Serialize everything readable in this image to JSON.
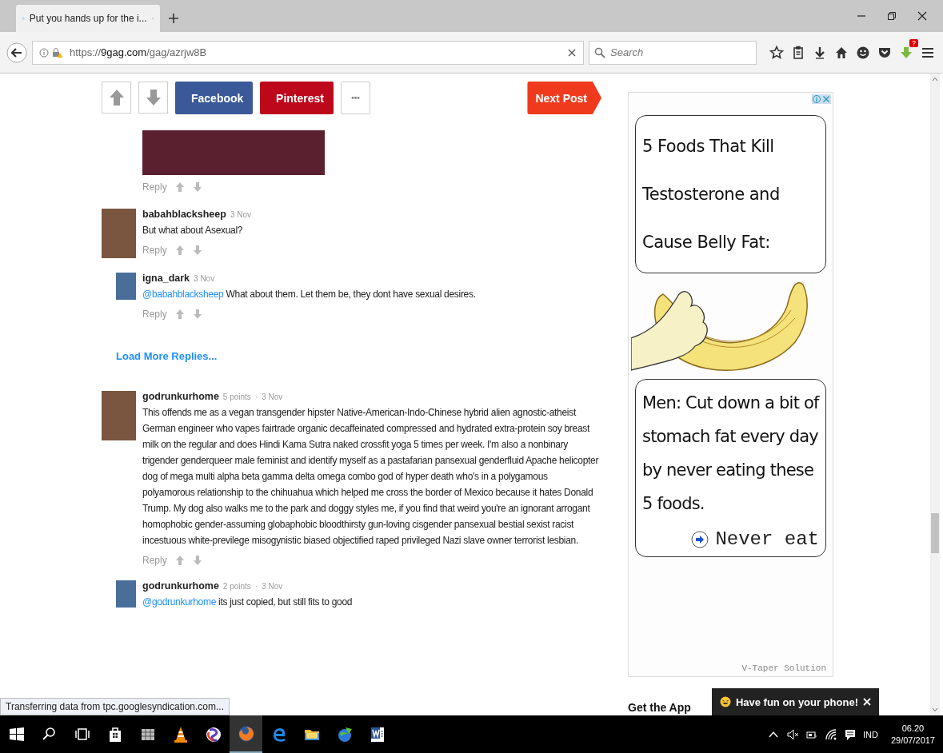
{
  "browser": {
    "tab_title": "Put you hands up for the i...",
    "url_scheme": "https://",
    "url_domain": "9gag.com",
    "url_path": "/gag/azrjw8B",
    "search": {
      "placeholder": "Search"
    },
    "badge": "?"
  },
  "post_bar": {
    "share": [
      {
        "kind": "facebook",
        "label": "Facebook"
      },
      {
        "kind": "pinterest",
        "label": "Pinterest"
      },
      {
        "kind": "more",
        "label": "•••"
      }
    ],
    "next": "Next Post"
  },
  "comments": [
    {
      "kind": "image",
      "reply": "Reply"
    },
    {
      "kind": "text",
      "user": "babahblacksheep",
      "date": "3 Nov",
      "text": "But what about Asexual?",
      "reply": "Reply",
      "children": [
        {
          "kind": "text",
          "user": "igna_dark",
          "date": "3 Nov",
          "mention": "@babahblacksheep",
          "text": "What about them. Let them be, they dont have sexual desires.",
          "reply": "Reply"
        }
      ]
    },
    {
      "kind": "more",
      "label": "Load More Replies..."
    },
    {
      "kind": "text",
      "user": "godrunkurhome",
      "points": "5 points",
      "sep": "·",
      "date": "3 Nov",
      "text": "This offends me as a vegan transgender hipster Native-American-Indo-Chinese hybrid alien agnostic-atheist German engineer who vapes fairtrade organic decaffeinated compressed and hydrated extra-protein soy breast milk on the regular and does Hindi Kama Sutra naked crossfit yoga 5 times per week. I'm also a nonbinary trigender genderqueer male feminist and identify myself as a pastafarian pansexual genderfluid Apache helicopter dog of mega multi alpha beta gamma delta omega combo god of hyper death who's in a polygamous polyamorous relationship to the chihuahua which helped me cross the border of Mexico because it hates Donald Trump. My dog also walks me to the park and doggy styles me, if you find that weird you're an ignorant arrogant homophobic gender-assuming globaphobic bloodthirsty gun-loving cisgender pansexual bestial sexist racist incestuous white-previlege misogynistic biased objectified raped privileged Nazi slave owner terrorist lesbian.",
      "reply": "Reply",
      "children": [
        {
          "kind": "text",
          "user": "godrunkurhome",
          "points": "2 points",
          "sep": "·",
          "date": "3 Nov",
          "mention": "@godrunkurhome",
          "text": "its just copied, but still fits to good"
        }
      ]
    }
  ],
  "ad": {
    "headline": "5 Foods That Kill Testosterone and Cause Belly Fat:",
    "body": "Men: Cut down a bit of stomach fat every day by never eating these 5 foods.",
    "cta": "Never eat",
    "sponsor": "V-Taper Solution"
  },
  "get_app": "Get the App",
  "toast": "Have fun on your phone!",
  "status_bar": "Transferring data from tpc.googlesyndication.com...",
  "taskbar": {
    "language": "IND",
    "time": "06.20",
    "date": "29/07/2017"
  }
}
